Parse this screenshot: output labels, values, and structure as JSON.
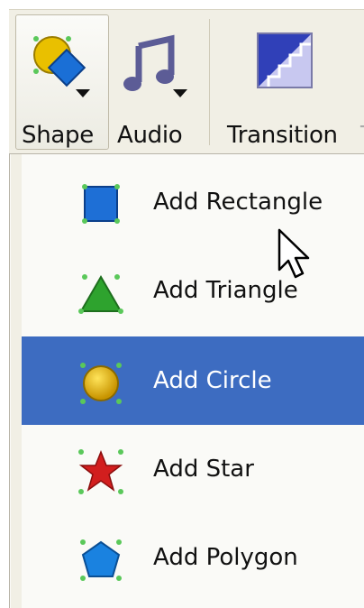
{
  "toolbar": {
    "buttons": [
      {
        "label": "Shape",
        "icon": "shape-icon",
        "has_dropdown": true
      },
      {
        "label": "Audio",
        "icon": "music-note-icon",
        "has_dropdown": true
      },
      {
        "label": "Transition",
        "icon": "transition-icon"
      }
    ],
    "clipped_label": "T"
  },
  "menu": {
    "items": [
      {
        "label": "Add Rectangle",
        "icon": "rectangle-icon",
        "active": false
      },
      {
        "label": "Add Triangle",
        "icon": "triangle-icon",
        "active": false
      },
      {
        "label": "Add Circle",
        "icon": "circle-icon",
        "active": true
      },
      {
        "label": "Add Star",
        "icon": "star-icon",
        "active": false
      },
      {
        "label": "Add Polygon",
        "icon": "polygon-icon",
        "active": false
      }
    ]
  },
  "colors": {
    "highlight": "#3d6cc1",
    "toolbar_bg": "#f1efe5",
    "rectangle": "#1e6fd6",
    "triangle": "#2ea32e",
    "circle": "#e3b400",
    "star": "#d21e1e",
    "polygon": "#1a82e0",
    "handle": "#5ac85a"
  }
}
